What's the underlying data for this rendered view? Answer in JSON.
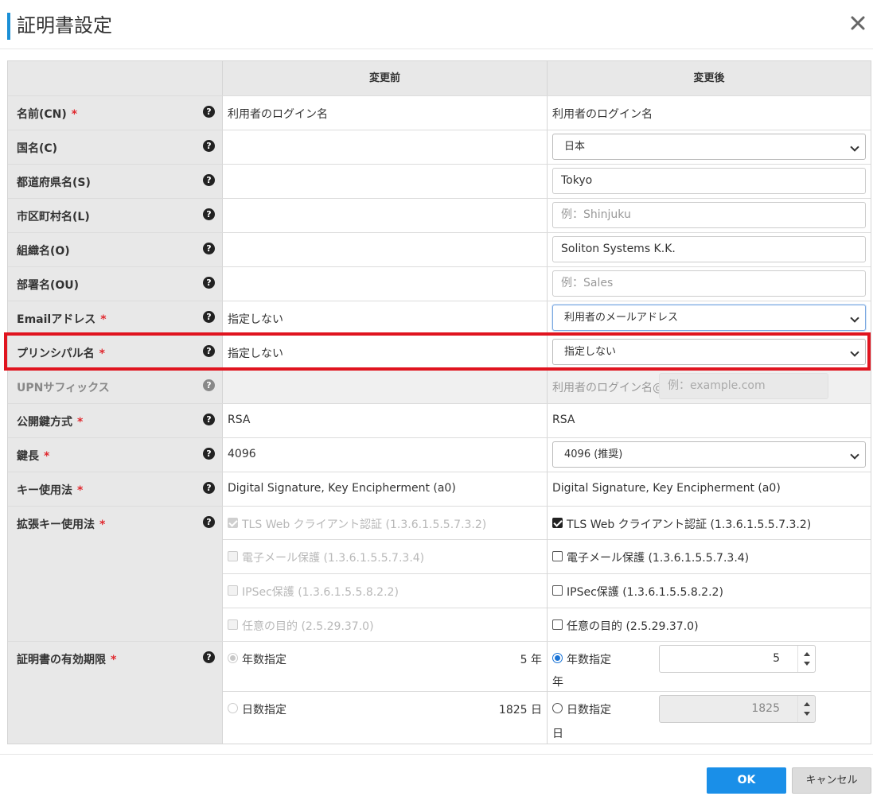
{
  "dialog": {
    "title": "証明書設定",
    "accent_color": "#1a8fd6",
    "close_icon": "close-icon"
  },
  "columns": {
    "before": "変更前",
    "after": "変更後"
  },
  "rows": {
    "cn": {
      "label": "名前(CN)",
      "required": "*",
      "before": "利用者のログイン名",
      "after": "利用者のログイン名"
    },
    "c": {
      "label": "国名(C)",
      "after_select": "日本"
    },
    "s": {
      "label": "都道府県名(S)",
      "after_value": "Tokyo"
    },
    "l": {
      "label": "市区町村名(L)",
      "after_placeholder": "例：Shinjuku"
    },
    "o": {
      "label": "組織名(O)",
      "after_value": "Soliton Systems K.K."
    },
    "ou": {
      "label": "部署名(OU)",
      "after_placeholder": "例：Sales"
    },
    "email": {
      "label": "Emailアドレス",
      "required": "*",
      "before": "指定しない",
      "after_select": "利用者のメールアドレス"
    },
    "principal": {
      "label": "プリンシパル名",
      "required": "*",
      "before": "指定しない",
      "after_select": "指定しない"
    },
    "upn": {
      "label": "UPNサフィックス",
      "after_prefix": "利用者のログイン名@",
      "after_placeholder": "例：example.com"
    },
    "keytype": {
      "label": "公開鍵方式",
      "required": "*",
      "before": "RSA",
      "after": "RSA"
    },
    "keylen": {
      "label": "鍵長",
      "required": "*",
      "before": "4096",
      "after_select": "4096 (推奨)"
    },
    "keyusage": {
      "label": "キー使用法",
      "required": "*",
      "before": "Digital Signature, Key Encipherment (a0)",
      "after": "Digital Signature, Key Encipherment (a0)"
    },
    "eku": {
      "label": "拡張キー使用法",
      "required": "*",
      "items": [
        {
          "text": "TLS Web クライアント認証 (1.3.6.1.5.5.7.3.2)",
          "before_checked": true,
          "after_checked": true
        },
        {
          "text": "電子メール保護 (1.3.6.1.5.5.7.3.4)",
          "before_checked": false,
          "after_checked": false
        },
        {
          "text": "IPSec保護 (1.3.6.1.5.5.8.2.2)",
          "before_checked": false,
          "after_checked": false
        },
        {
          "text": "任意の目的 (2.5.29.37.0)",
          "before_checked": false,
          "after_checked": false
        }
      ]
    },
    "validity": {
      "label": "証明書の有効期限",
      "required": "*",
      "years_label": "年数指定",
      "days_label": "日数指定",
      "before_years": "5 年",
      "before_days": "1825 日",
      "after_years_value": "5",
      "after_days_value": "1825",
      "year_unit": "年",
      "day_unit": "日",
      "selected": "years"
    }
  },
  "help_icon": "?",
  "footer": {
    "ok_label": "OK",
    "cancel_label": "キャンセル",
    "ok_color": "#1a8fe8"
  },
  "highlight_color": "#e0141f"
}
